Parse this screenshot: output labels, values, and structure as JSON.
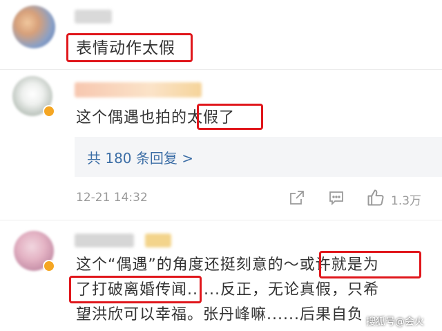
{
  "comments": [
    {
      "text": "表情动作太假"
    },
    {
      "text_before": "这个偶遇也拍的",
      "text_highlight": "太假了"
    },
    {
      "line1_before": "这个“偶遇”的角度还挺刻意的～",
      "line1_highlight": "或许就是为",
      "line2_highlight": "了打破离婚传闻",
      "line2_after": "......反正，无论真假，只希",
      "line3": "望洪欣可以幸福。张丹峰嘛......后果自负"
    }
  ],
  "replies": {
    "label": "共 180 条回复 >"
  },
  "meta": {
    "timestamp": "12-21 14:32",
    "like_count": "1.3万"
  },
  "watermark": {
    "text": "搜狐号@会火"
  },
  "colors": {
    "highlight_border": "#e0161b",
    "link": "#3c6ea6"
  },
  "icons": {
    "share": "share-icon",
    "comment": "comment-icon",
    "like": "thumbs-up-icon"
  }
}
